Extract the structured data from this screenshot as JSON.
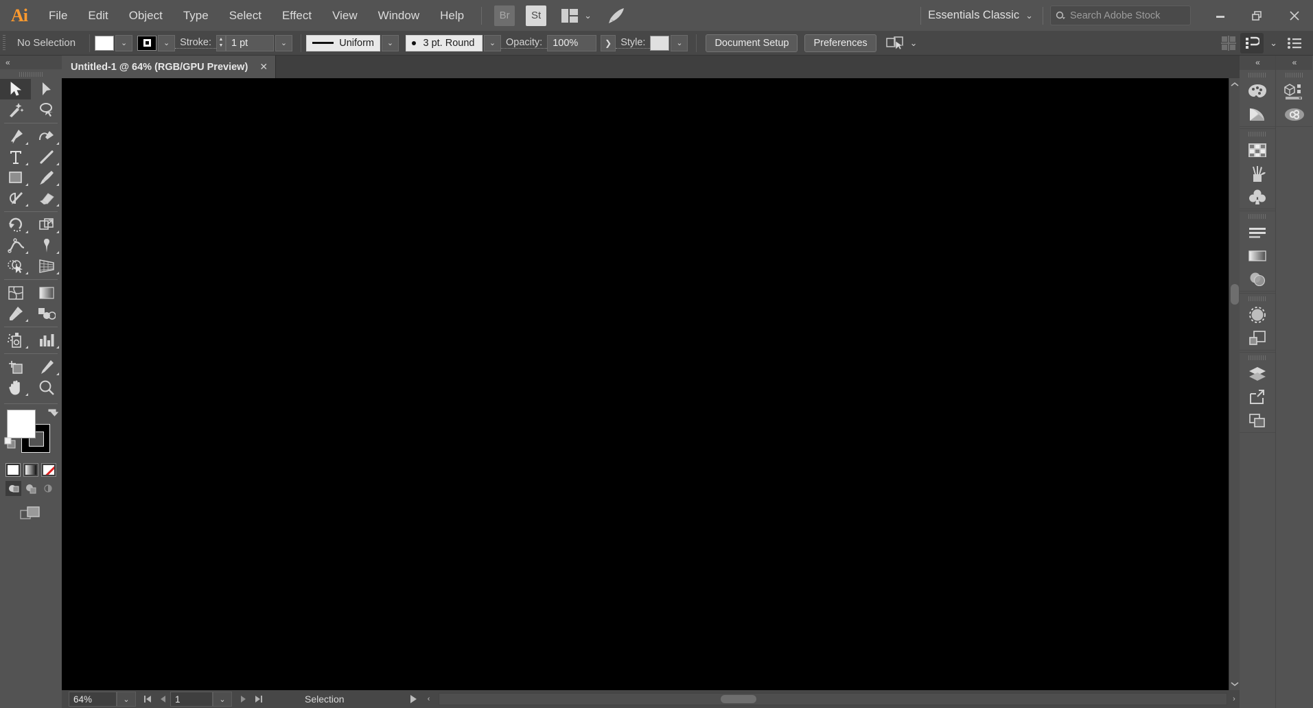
{
  "app": {
    "name": "Adobe Illustrator",
    "logo_text": "Ai",
    "accent": "#ff9a2e",
    "chrome_bg": "#535353",
    "canvas_bg": "#000000"
  },
  "menubar": {
    "items": [
      {
        "label": "File"
      },
      {
        "label": "Edit"
      },
      {
        "label": "Object"
      },
      {
        "label": "Type"
      },
      {
        "label": "Select"
      },
      {
        "label": "Effect"
      },
      {
        "label": "View"
      },
      {
        "label": "Window"
      },
      {
        "label": "Help"
      }
    ],
    "bridge_badge": "Br",
    "stock_badge": "St",
    "arrange_documents_icon": "arrange-documents-icon",
    "arrange_chevron": "⌄",
    "rocket_icon": "rocket-icon",
    "workspace": {
      "label": "Essentials Classic",
      "chevron": "⌄"
    },
    "search": {
      "placeholder": "Search Adobe Stock",
      "icon": "search-icon"
    },
    "window_controls": {
      "minimize": "minimize-icon",
      "restore": "restore-icon",
      "close": "✕"
    }
  },
  "controlbar": {
    "selection_status": "No Selection",
    "fill_swatch_color": "#ffffff",
    "stroke_swatch_color": "#000000",
    "stroke_label": "Stroke:",
    "stroke_weight": "1 pt",
    "stroke_profile": "Uniform",
    "brush_definition": "3 pt. Round",
    "opacity_label": "Opacity:",
    "opacity_value": "100%",
    "style_label": "Style:",
    "style_swatch_color": "#e0e0e0",
    "more_arrow": "❯",
    "buttons": [
      {
        "label": "Document Setup"
      },
      {
        "label": "Preferences"
      }
    ],
    "select_similar_icon": "select-similar-objects-icon",
    "select_similar_chevron": "⌄",
    "right_icons": [
      {
        "name": "align-grid-icon",
        "active": false
      },
      {
        "name": "properties-panel-icon",
        "active": true
      },
      {
        "name": "chevron-down-icon",
        "active": false
      },
      {
        "name": "list-view-icon",
        "active": false
      }
    ]
  },
  "toolbar": {
    "collapse_icon": "«",
    "tools": [
      {
        "name": "selection-tool",
        "selected": true,
        "more": false
      },
      {
        "name": "direct-selection-tool",
        "selected": false,
        "more": false
      },
      {
        "name": "magic-wand-tool",
        "selected": false,
        "more": false
      },
      {
        "name": "lasso-tool",
        "selected": false,
        "more": false
      },
      {
        "name": "pen-tool",
        "selected": false,
        "more": true
      },
      {
        "name": "curvature-tool",
        "selected": false,
        "more": true
      },
      {
        "name": "type-tool",
        "selected": false,
        "more": true
      },
      {
        "name": "line-segment-tool",
        "selected": false,
        "more": true
      },
      {
        "name": "rectangle-tool",
        "selected": false,
        "more": true
      },
      {
        "name": "paintbrush-tool",
        "selected": false,
        "more": true
      },
      {
        "name": "shaper-tool",
        "selected": false,
        "more": true
      },
      {
        "name": "eraser-tool",
        "selected": false,
        "more": true
      },
      {
        "name": "rotate-tool",
        "selected": false,
        "more": true
      },
      {
        "name": "scale-tool",
        "selected": false,
        "more": true
      },
      {
        "name": "width-tool",
        "selected": false,
        "more": true
      },
      {
        "name": "free-transform-tool",
        "selected": false,
        "more": true
      },
      {
        "name": "shape-builder-tool",
        "selected": false,
        "more": true
      },
      {
        "name": "perspective-grid-tool",
        "selected": false,
        "more": true
      },
      {
        "name": "mesh-tool",
        "selected": false,
        "more": false
      },
      {
        "name": "gradient-tool",
        "selected": false,
        "more": false
      },
      {
        "name": "eyedropper-tool",
        "selected": false,
        "more": true
      },
      {
        "name": "blend-tool",
        "selected": false,
        "more": false
      },
      {
        "name": "symbol-sprayer-tool",
        "selected": false,
        "more": true
      },
      {
        "name": "column-graph-tool",
        "selected": false,
        "more": true
      },
      {
        "name": "artboard-tool",
        "selected": false,
        "more": false
      },
      {
        "name": "slice-tool",
        "selected": false,
        "more": true
      },
      {
        "name": "hand-tool",
        "selected": false,
        "more": true
      },
      {
        "name": "zoom-tool",
        "selected": false,
        "more": false
      }
    ],
    "fill_color": "#ffffff",
    "stroke_color": "#000000",
    "swap_icon": "swap-fill-stroke-icon",
    "default_icon": "default-fill-stroke-icon",
    "paint_modes": [
      {
        "name": "color-swatch",
        "active": true
      },
      {
        "name": "gradient-swatch",
        "active": false
      },
      {
        "name": "none-swatch",
        "active": false
      }
    ],
    "draw_modes": [
      {
        "name": "draw-normal-icon",
        "active": true
      },
      {
        "name": "draw-behind-icon",
        "active": false
      },
      {
        "name": "draw-inside-icon",
        "active": false
      }
    ],
    "screen_mode_icon": "change-screen-mode-icon"
  },
  "document": {
    "tab_title": "Untitled-1 @ 64% (RGB/GPU Preview)",
    "close_icon": "✕"
  },
  "statusbar": {
    "zoom_value": "64%",
    "zoom_chevron": "⌄",
    "first_page_icon": "first-artboard-icon",
    "prev_page_icon": "previous-artboard-icon",
    "page_value": "1",
    "page_chevron": "⌄",
    "next_page_icon": "next-artboard-icon",
    "last_page_icon": "last-artboard-icon",
    "status_text": "Selection",
    "status_menu_icon": "status-menu-icon",
    "scroll_left_icon": "‹",
    "scroll_right_icon": "›"
  },
  "right_dock": {
    "collapse_left_icon": "«",
    "collapse_right_icon": "«",
    "left_column_groups": [
      {
        "items": [
          {
            "name": "color-panel-icon"
          },
          {
            "name": "color-guide-panel-icon"
          }
        ]
      },
      {
        "items": [
          {
            "name": "swatches-panel-icon"
          },
          {
            "name": "brushes-panel-icon"
          },
          {
            "name": "symbols-panel-icon"
          }
        ]
      },
      {
        "items": [
          {
            "name": "align-panel-icon"
          },
          {
            "name": "gradient-panel-icon"
          },
          {
            "name": "transparency-panel-icon"
          }
        ]
      },
      {
        "items": [
          {
            "name": "appearance-panel-icon"
          },
          {
            "name": "pathfinder-panel-icon"
          }
        ]
      },
      {
        "items": [
          {
            "name": "layers-panel-icon"
          },
          {
            "name": "artboards-panel-icon"
          },
          {
            "name": "asset-export-panel-icon"
          }
        ]
      }
    ],
    "right_column_groups": [
      {
        "items": [
          {
            "name": "libraries-panel-icon"
          },
          {
            "name": "creative-cloud-icon"
          }
        ]
      }
    ]
  }
}
